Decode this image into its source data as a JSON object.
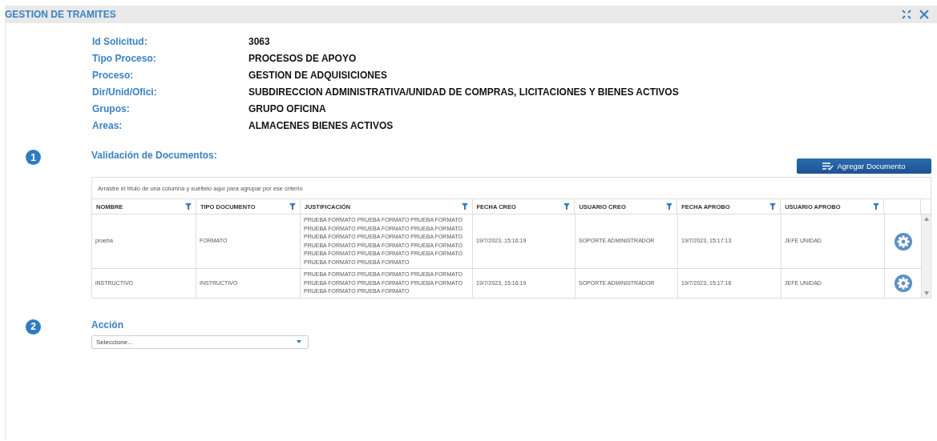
{
  "window": {
    "title": "GESTION DE TRAMITES"
  },
  "details": [
    {
      "label": "Id Solicitud:",
      "value": "3063"
    },
    {
      "label": "Tipo Proceso:",
      "value": "PROCESOS DE APOYO"
    },
    {
      "label": "Proceso:",
      "value": "GESTION DE ADQUISICIONES"
    },
    {
      "label": "Dir/Unid/Ofici:",
      "value": "SUBDIRECCION ADMINISTRATIVA/UNIDAD DE COMPRAS, LICITACIONES Y BIENES ACTIVOS"
    },
    {
      "label": "Grupos:",
      "value": "GRUPO OFICINA"
    },
    {
      "label": "Areas:",
      "value": "ALMACENES BIENES ACTIVOS"
    }
  ],
  "step_1": {
    "number": "1",
    "title": "Validación de Documentos:",
    "button": "Agregar Documento",
    "group_hint": "Arrastre el título de una columna y suéltelo aquí para agrupar por ese criterio",
    "columns": [
      "NOMBRE",
      "TIPO DOCUMENTO",
      "JUSTIFICACIÓN",
      "FECHA CREO",
      "USUARIO CREO",
      "FECHA APROBO",
      "USUARIO APROBO"
    ],
    "rows": [
      {
        "cells": [
          "prueba",
          "FORMATO",
          "PRUEBA FORMATO PRUEBA FORMATO PRUEBA FORMATO PRUEBA FORMATO PRUEBA FORMATO PRUEBA FORMATO PRUEBA FORMATO PRUEBA FORMATO PRUEBA FORMATO PRUEBA FORMATO PRUEBA FORMATO PRUEBA FORMATO PRUEBA FORMATO PRUEBA FORMATO PRUEBA FORMATO PRUEBA FORMATO PRUEBA FORMATO",
          "19/7/2023, 15:16:19",
          "SOPORTE ADMINISTRADOR",
          "19/7/2023, 15:17:13",
          "JEFE UNIDAD"
        ]
      },
      {
        "cells": [
          "iNSTRUCTIVO",
          "INSTRUCTIVO",
          "PRUEBA FORMATO PRUEBA FORMATO PRUEBA FORMATO PRUEBA FORMATO PRUEBA FORMATO PRUEBA FORMATO PRUEBA FORMATO PRUEBA FORMATO",
          "19/7/2023, 15:16:19",
          "SOPORTE ADMINISTRADOR",
          "19/7/2023, 15:17:16",
          "JEFE UNIDAD"
        ]
      }
    ]
  },
  "step_2": {
    "number": "2",
    "title": "Acción",
    "select": {
      "value": "Seleccione..."
    }
  }
}
